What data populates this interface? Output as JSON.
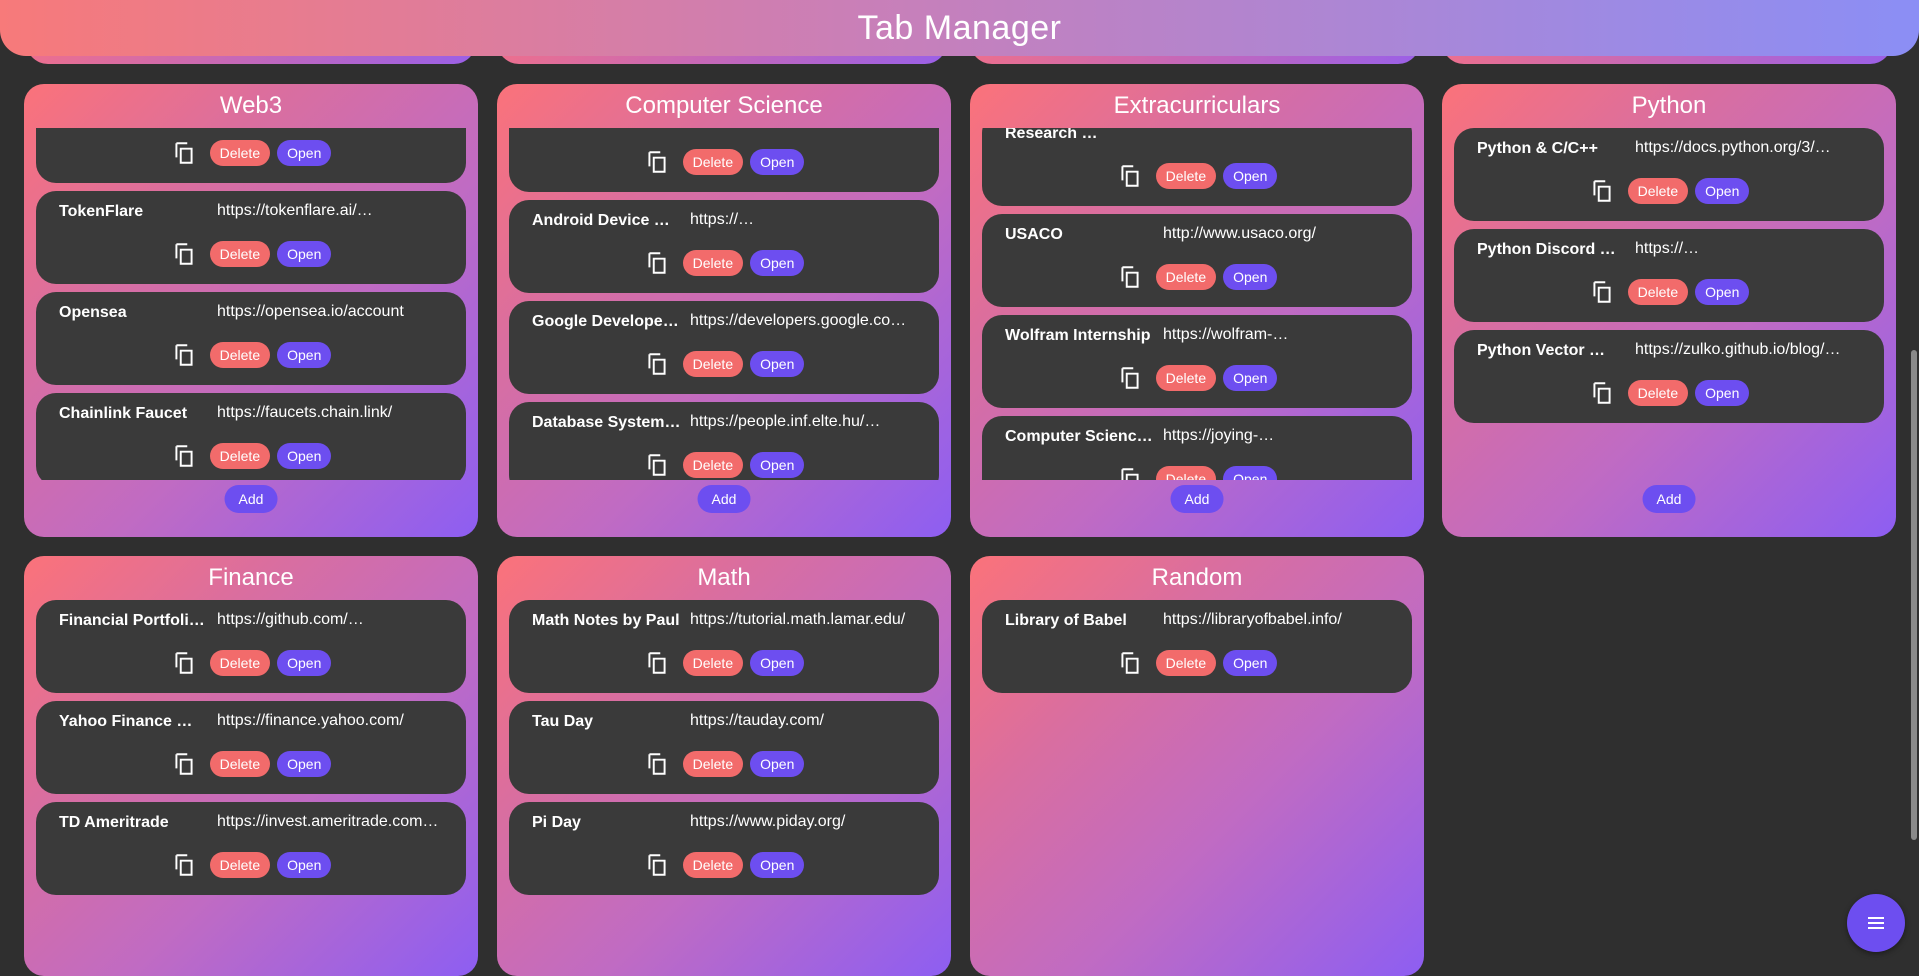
{
  "app": {
    "title": "Tab Manager"
  },
  "labels": {
    "delete": "Delete",
    "open": "Open",
    "add": "Add"
  },
  "icons": {
    "copy": "copy-icon",
    "menu": "menu-icon"
  },
  "colors": {
    "delete": "#f26b6b",
    "open": "#6d4ef0",
    "card": "#3a3a3a",
    "background": "#2f2f2f"
  },
  "categories": [
    {
      "title": "Web3",
      "items": [
        {
          "name": "",
          "url": ""
        },
        {
          "name": "TokenFlare",
          "url": "https://tokenflare.ai/…"
        },
        {
          "name": "Opensea",
          "url": "https://opensea.io/account"
        },
        {
          "name": "Chainlink Faucet",
          "url": "https://faucets.chain.link/"
        }
      ]
    },
    {
      "title": "Computer Science",
      "items": [
        {
          "name": "",
          "url": ""
        },
        {
          "name": "Android Device …",
          "url": "https://…"
        },
        {
          "name": "Google Developer…",
          "url": "https://developers.google.co…"
        },
        {
          "name": "Database System…",
          "url": "https://people.inf.elte.hu/…"
        }
      ]
    },
    {
      "title": "Extracurriculars",
      "items": [
        {
          "name": "Research …",
          "url": ""
        },
        {
          "name": "USACO",
          "url": "http://www.usaco.org/"
        },
        {
          "name": "Wolfram Internship",
          "url": "https://wolfram-…"
        },
        {
          "name": "Computer Science…",
          "url": "https://joying-…"
        }
      ]
    },
    {
      "title": "Python",
      "items": [
        {
          "name": "Python & C/C++",
          "url": "https://docs.python.org/3/…"
        },
        {
          "name": "Python Discord …",
          "url": "https://…"
        },
        {
          "name": "Python Vector …",
          "url": "https://zulko.github.io/blog/…"
        }
      ]
    },
    {
      "title": "Finance",
      "items": [
        {
          "name": "Financial Portfolio…",
          "url": "https://github.com/…"
        },
        {
          "name": "Yahoo Finance …",
          "url": "https://finance.yahoo.com/"
        },
        {
          "name": "TD Ameritrade",
          "url": "https://invest.ameritrade.com…"
        }
      ]
    },
    {
      "title": "Math",
      "items": [
        {
          "name": "Math Notes by Paul",
          "url": "https://tutorial.math.lamar.edu/"
        },
        {
          "name": "Tau Day",
          "url": "https://tauday.com/"
        },
        {
          "name": "Pi Day",
          "url": "https://www.piday.org/"
        }
      ]
    },
    {
      "title": "Random",
      "items": [
        {
          "name": "Library of Babel",
          "url": "https://libraryofbabel.info/"
        }
      ]
    }
  ]
}
